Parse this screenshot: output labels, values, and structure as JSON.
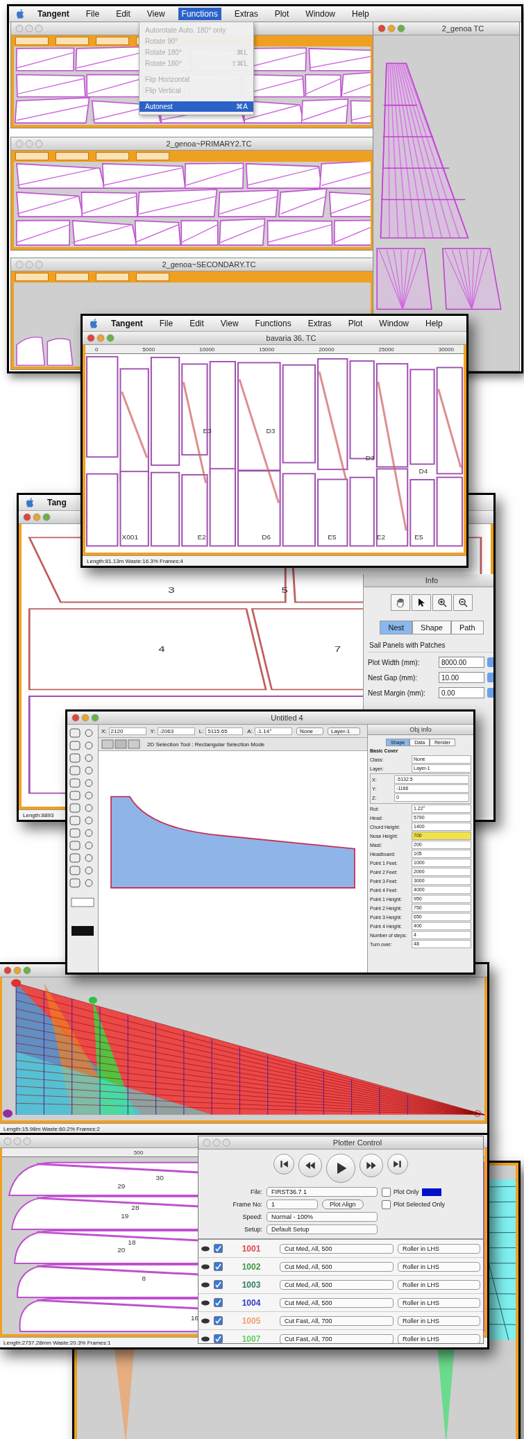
{
  "menu_bar": {
    "items": [
      {
        "label": "Tangent",
        "selected": false
      },
      {
        "label": "File",
        "selected": false
      },
      {
        "label": "Edit",
        "selected": false
      },
      {
        "label": "View",
        "selected": false
      },
      {
        "label": "Functions",
        "selected": true
      },
      {
        "label": "Extras",
        "selected": false
      },
      {
        "label": "Plot",
        "selected": false
      },
      {
        "label": "Window",
        "selected": false
      },
      {
        "label": "Help",
        "selected": false
      }
    ]
  },
  "functions_menu": {
    "items": [
      {
        "label": "Autorotate Auto. 180° only",
        "disabled": true,
        "selected": false
      },
      {
        "label": "Rotate 90°",
        "disabled": true,
        "selected": false
      },
      {
        "label": "Rotate 180°",
        "shortcut": "⌘L",
        "disabled": true,
        "selected": false
      },
      {
        "label": "Rotate 180°",
        "shortcut": "⇧⌘L",
        "disabled": true,
        "selected": false
      },
      {
        "label": "Flip Horizontal",
        "disabled": true,
        "selected": false
      },
      {
        "label": "Flip Vertical",
        "disabled": true,
        "selected": false
      },
      {
        "label": "Autonest",
        "shortcut": "⌘A",
        "disabled": false,
        "selected": true
      }
    ]
  },
  "nest_windows": [
    {
      "title": "2_genoa~PRIMARY2.TC"
    },
    {
      "title": "2_genoa~SECONDARY.TC"
    }
  ],
  "side_window": {
    "title": "2_genoa TC"
  },
  "bavaria_window": {
    "menu": [
      {
        "label": "Tangent",
        "selected": false
      },
      {
        "label": "File",
        "selected": false
      },
      {
        "label": "Edit",
        "selected": false
      },
      {
        "label": "View",
        "selected": false
      },
      {
        "label": "Functions",
        "selected": false
      },
      {
        "label": "Extras",
        "selected": false
      },
      {
        "label": "Plot",
        "selected": false
      },
      {
        "label": "Window",
        "selected": false
      },
      {
        "label": "Help",
        "selected": false
      }
    ],
    "title": "bavaria 36. TC",
    "ruler": [
      "0",
      "5000",
      "10000",
      "15000",
      "20000",
      "25000",
      "30000"
    ],
    "panels": [
      "E3",
      "D3",
      "D3",
      "D4",
      "X001",
      "E2",
      "D6",
      "E5",
      "E2",
      "E5"
    ],
    "status": "Length:81.13m Waste:16.3% Frames:4"
  },
  "nest_window": {
    "app": "Tang",
    "panels": [
      "3",
      "5",
      "4",
      "7"
    ],
    "status": "Length:8893"
  },
  "info_palette": {
    "title": "Info",
    "tabs": [
      {
        "label": "Nest",
        "selected": true
      },
      {
        "label": "Shape",
        "selected": false
      },
      {
        "label": "Path",
        "selected": false
      }
    ],
    "heading": "Sail Panels with Patches",
    "fields": [
      {
        "label": "Plot Width (mm):",
        "value": "8000.00"
      },
      {
        "label": "Nest Gap (mm):",
        "value": "10.00"
      },
      {
        "label": "Nest Margin (mm):",
        "value": "0.00"
      }
    ]
  },
  "cad_window": {
    "title": "Untitled 4",
    "coords": [
      {
        "label": "X:",
        "value": "2120"
      },
      {
        "label": "Y:",
        "value": "-2063"
      },
      {
        "label": "L:",
        "value": "5115.65"
      },
      {
        "label": "A:",
        "value": "-1.14°"
      }
    ],
    "class_popup": "None",
    "layer_popup": "Layer-1",
    "tool_hint": "2D Selection Tool : Rectangular Selection Mode"
  },
  "obj_info": {
    "title": "Obj Info",
    "tabs": [
      {
        "label": "Shape",
        "selected": true
      },
      {
        "label": "Data",
        "selected": false
      },
      {
        "label": "Render",
        "selected": false
      }
    ],
    "object": "Basic Cover",
    "rows": [
      {
        "label": "Class:",
        "value": "None"
      },
      {
        "label": "Layer:",
        "value": "Layer-1"
      }
    ],
    "xyz": [
      {
        "label": "X:",
        "value": "-5132.5"
      },
      {
        "label": "Y:",
        "value": "-1166"
      },
      {
        "label": "Z:",
        "value": "0"
      }
    ],
    "params": [
      {
        "label": "Rot:",
        "value": "1.22°",
        "highlighted": false
      },
      {
        "label": "Head:",
        "value": "5790",
        "highlighted": false
      },
      {
        "label": "Chord Height:",
        "value": "1400",
        "highlighted": false
      },
      {
        "label": "Nose Height:",
        "value": "700",
        "highlighted": true
      },
      {
        "label": "Mast:",
        "value": "200",
        "highlighted": false
      },
      {
        "label": "Headboard:",
        "value": "105",
        "highlighted": false
      },
      {
        "label": "Point 1 Feet:",
        "value": "1000",
        "highlighted": false
      },
      {
        "label": "Point 2 Feet:",
        "value": "2000",
        "highlighted": false
      },
      {
        "label": "Point 3 Feet:",
        "value": "3000",
        "highlighted": false
      },
      {
        "label": "Point 4 Feet:",
        "value": "4000",
        "highlighted": false
      },
      {
        "label": "Point 1 Height:",
        "value": "950",
        "highlighted": false
      },
      {
        "label": "Point 2 Height:",
        "value": "750",
        "highlighted": false
      },
      {
        "label": "Point 3 Height:",
        "value": "650",
        "highlighted": false
      },
      {
        "label": "Point 4 Height:",
        "value": "400",
        "highlighted": false
      },
      {
        "label": "Number of steps:",
        "value": "4",
        "highlighted": false
      },
      {
        "label": "Turn over:",
        "value": "48",
        "highlighted": false
      }
    ]
  },
  "sail_window": {
    "status": "Length:15.98m Waste:60.2% Frames:2"
  },
  "strip_window": {
    "ruler": "500",
    "labels": [
      "30",
      "29",
      "28",
      "19",
      "18",
      "20",
      "8",
      "16"
    ],
    "status": "Length:2737.28mm Waste:20.3% Frames:1"
  },
  "plotter": {
    "title": "Plotter Control",
    "file_label": "File:",
    "file": "FIRST36.7 1",
    "frame_label": "Frame No:",
    "frame": "1",
    "align": "Plot Align",
    "speed_label": "Speed:",
    "speed": "Normal - 100%",
    "setup_label": "Setup:",
    "setup": "Default Setup",
    "options": [
      {
        "label": "Plot Only",
        "checked": false
      },
      {
        "label": "Plot Selected Only",
        "checked": false
      }
    ],
    "jobs": [
      {
        "id": "1001",
        "color": "#e04848",
        "checked": true,
        "tool": "Cut Med, All, 500",
        "holder": "Roller in LHS"
      },
      {
        "id": "1002",
        "color": "#3c9a3c",
        "checked": true,
        "tool": "Cut Med, All, 500",
        "holder": "Roller in LHS"
      },
      {
        "id": "1003",
        "color": "#2f7f5f",
        "checked": true,
        "tool": "Cut Med, All, 500",
        "holder": "Roller in LHS"
      },
      {
        "id": "1004",
        "color": "#3038c8",
        "checked": true,
        "tool": "Cut Med, All, 500",
        "holder": "Roller in LHS"
      },
      {
        "id": "1005",
        "color": "#f0a070",
        "checked": true,
        "tool": "Cut Fast, All, 700",
        "holder": "Roller in LHS"
      },
      {
        "id": "1007",
        "color": "#60d060",
        "checked": true,
        "tool": "Cut Fast, All, 700",
        "holder": "Roller in LHS"
      }
    ]
  }
}
